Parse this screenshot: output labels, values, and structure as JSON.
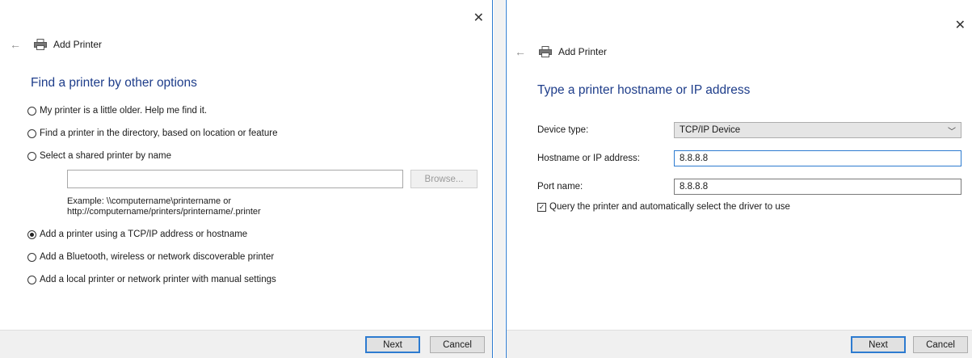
{
  "left_dialog": {
    "title": "Add Printer",
    "heading": "Find a printer by other options",
    "options": [
      {
        "label": "My printer is a little older. Help me find it.",
        "checked": false
      },
      {
        "label": "Find a printer in the directory, based on location or feature",
        "checked": false
      },
      {
        "label": "Select a shared printer by name",
        "checked": false
      },
      {
        "label": "Add a printer using a TCP/IP address or hostname",
        "checked": true
      },
      {
        "label": "Add a Bluetooth, wireless or network discoverable printer",
        "checked": false
      },
      {
        "label": "Add a local printer or network printer with manual settings",
        "checked": false
      }
    ],
    "shared_printer_value": "",
    "browse_label": "Browse...",
    "example_line1": "Example: \\\\computername\\printername or",
    "example_line2": "http://computername/printers/printername/.printer",
    "next_label": "Next",
    "cancel_label": "Cancel"
  },
  "right_dialog": {
    "title": "Add Printer",
    "heading": "Type a printer hostname or IP address",
    "device_type_label": "Device type:",
    "device_type_value": "TCP/IP Device",
    "hostname_label": "Hostname or IP address:",
    "hostname_value": "8.8.8.8",
    "port_label": "Port name:",
    "port_value": "8.8.8.8",
    "query_label": "Query the printer and automatically select the driver to use",
    "query_checked": true,
    "next_label": "Next",
    "cancel_label": "Cancel"
  },
  "icons": {
    "close": "close-icon",
    "back": "back-arrow-icon",
    "printer": "printer-icon",
    "dropdown": "chevron-down-icon"
  },
  "colors": {
    "heading": "#1e3d8a",
    "accent": "#2d7bd0",
    "footer": "#f0f0f0"
  }
}
